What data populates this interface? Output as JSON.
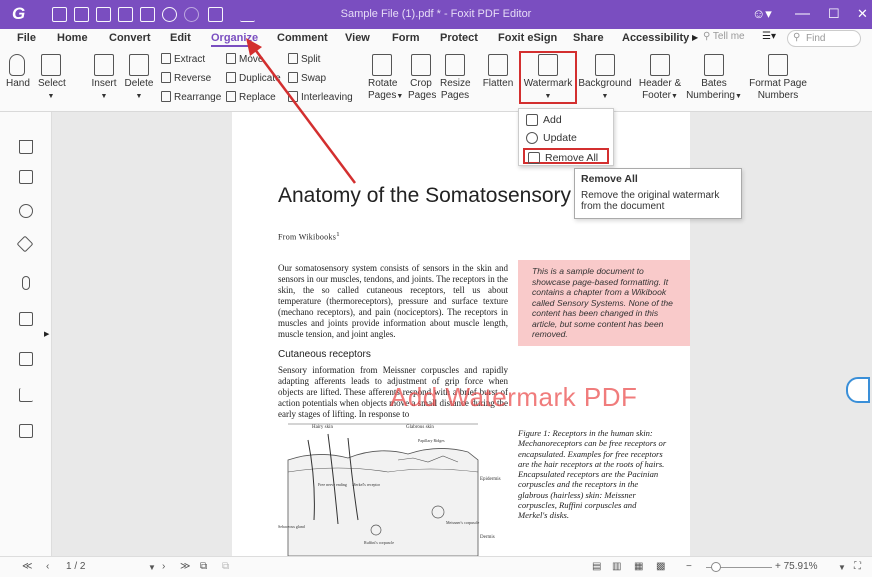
{
  "titlebar": {
    "title": "Sample File (1).pdf * - Foxit PDF Editor",
    "minimize": "—",
    "maximize": "☐",
    "close": "✕",
    "account_icon": "account-icon"
  },
  "menu": {
    "tabs": [
      "File",
      "Home",
      "Convert",
      "Edit",
      "Organize",
      "Comment",
      "View",
      "Form",
      "Protect",
      "Foxit eSign",
      "Share",
      "Accessibility"
    ],
    "tell_me": "Tell me",
    "find": "Find"
  },
  "ribbon": {
    "hand": "Hand",
    "select": "Select",
    "insert": "Insert",
    "delete": "Delete",
    "extract": "Extract",
    "reverse": "Reverse",
    "rearrange": "Rearrange",
    "move": "Move",
    "duplicate": "Duplicate",
    "replace": "Replace",
    "split": "Split",
    "swap": "Swap",
    "interleaving": "Interleaving",
    "rotate_pages_1": "Rotate",
    "rotate_pages_2": "Pages",
    "crop_pages_1": "Crop",
    "crop_pages_2": "Pages",
    "resize_pages_1": "Resize",
    "resize_pages_2": "Pages",
    "flatten": "Flatten",
    "watermark": "Watermark",
    "background": "Background",
    "header_footer_1": "Header &",
    "header_footer_2": "Footer",
    "bates_1": "Bates",
    "bates_2": "Numbering",
    "format_page_1": "Format Page",
    "format_page_2": "Numbers"
  },
  "watermark_menu": {
    "items": [
      "Add",
      "Update",
      "Remove All"
    ]
  },
  "tooltip": {
    "title": "Remove All",
    "description": "Remove the original watermark from the document"
  },
  "document": {
    "title": "Anatomy of the Somatosensory Sy",
    "from": "From Wikibooks",
    "from_sup": "1",
    "para1": "Our somatosensory system consists of sensors in the skin and sensors in our muscles, tendons, and joints. The receptors in the skin, the so called cutaneous receptors, tell us about temperature (thermoreceptors), pressure and surface texture (mechano receptors), and pain (nociceptors). The receptors in muscles and joints provide information about muscle length, muscle tension, and joint angles.",
    "note": "This is a sample document to showcase page-based formatting. It contains a chapter from a Wikibook called Sensory Systems. None of the content has been changed in this article, but some content has been removed.",
    "section": "Cutaneous receptors",
    "para2": "Sensory information from Meissner corpuscles and rapidly adapting afferents leads to adjustment of grip force when objects are lifted. These afferents respond with a brief burst of action potentials when objects move a small distance during the early stages of lifting. In response to",
    "watermark": "Add Watermark PDF",
    "figure_labels": [
      "Hairy skin",
      "Glabrous skin",
      "Papillary Ridges",
      "Epidermis",
      "Dermis",
      "Free nerve ending",
      "Merkel's receptor",
      "Sebaceous gland",
      "Ruffini's corpuscle",
      "Meissner's corpuscle"
    ],
    "caption": "Figure 1: Receptors in the human skin: Mechanoreceptors can be free receptors or encapsulated. Examples for free receptors are the hair receptors at the roots of hairs. Encapsulated receptors are the Pacinian corpuscles and the receptors in the glabrous (hairless) skin: Meissner corpuscles, Ruffini corpuscles and Merkel's disks."
  },
  "statusbar": {
    "page": "1 / 2",
    "zoom": "+ 75.91%"
  }
}
